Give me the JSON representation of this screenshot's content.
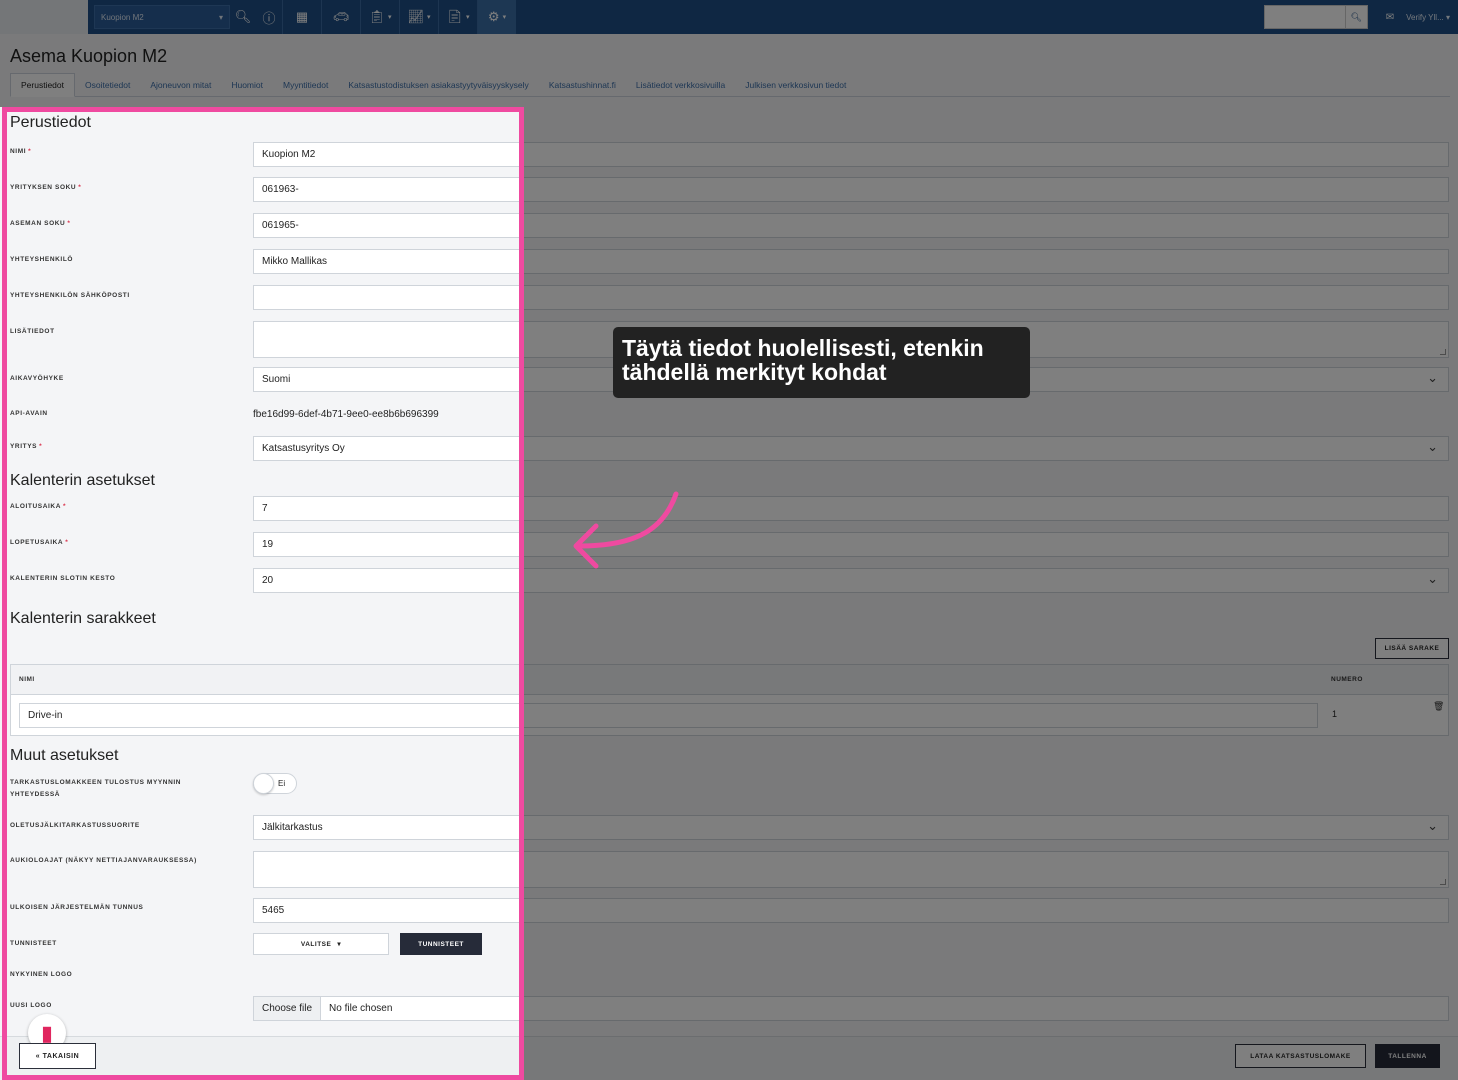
{
  "topbar": {
    "station_select": "Kuopion M2",
    "user": "Verify Yll...",
    "icons": [
      "search-icon",
      "info-icon",
      "calendar-icon",
      "car-icon",
      "clipboard-icon",
      "chart-icon",
      "document-icon",
      "gear-icon"
    ]
  },
  "page": {
    "title": "Asema Kuopion M2",
    "tabs": [
      "Perustiedot",
      "Osoitetiedot",
      "Ajoneuvon mitat",
      "Huomiot",
      "Myyntitiedot",
      "Katsastustodistuksen asiakastyytyväisyyskysely",
      "Katsastushinnat.fi",
      "Lisätiedot verkkosivuilla",
      "Julkisen verkkosivun tiedot"
    ]
  },
  "sections": {
    "basic": "Perustiedot",
    "calendar_settings": "Kalenterin asetukset",
    "calendar_columns": "Kalenterin sarakkeet",
    "other_settings": "Muut asetukset"
  },
  "fields": {
    "name": {
      "label": "NIMI",
      "value": "Kuopion M2",
      "required": "*"
    },
    "company_id": {
      "label": "YRITYKSEN SOKU",
      "value": "061963-",
      "required": "*"
    },
    "station_id": {
      "label": "ASEMAN SOKU",
      "value": "061965-",
      "required": "*"
    },
    "contact": {
      "label": "YHTEYSHENKILÖ",
      "value": "Mikko Mallikas"
    },
    "contact_email": {
      "label": "YHTEYSHENKILÖN SÄHKÖPOSTI",
      "value": ""
    },
    "extra_info": {
      "label": "LISÄTIEDOT",
      "value": ""
    },
    "timezone": {
      "label": "AIKAVYÖHYKE",
      "value": "Suomi"
    },
    "api_key": {
      "label": "API-AVAIN",
      "value": "fbe16d99-6def-4b71-9ee0-ee8b6b696399"
    },
    "company": {
      "label": "YRITYS",
      "value": "Katsastusyritys Oy",
      "required": "*"
    },
    "start_time": {
      "label": "ALOITUSAIKA",
      "value": "7",
      "required": "*"
    },
    "end_time": {
      "label": "LOPETUSAIKA",
      "value": "19",
      "required": "*"
    },
    "slot_length": {
      "label": "KALENTERIN SLOTIN KESTO",
      "value": "20"
    },
    "print_form": {
      "label": "TARKASTUSLOMAKKEEN TULOSTUS MYYNNIN YHTEYDESSÄ",
      "value": "Ei"
    },
    "default_reinspection": {
      "label": "OLETUSJÄLKITARKASTUSSUORITE",
      "value": "Jälkitarkastus"
    },
    "opening_hours": {
      "label": "AUKIOLOAJAT (NÄKYY NETTIAJANVARAUKSESSA)",
      "value": ""
    },
    "external_id": {
      "label": "ULKOISEN JÄRJESTELMÄN TUNNUS",
      "value": "5465"
    },
    "tags": {
      "label": "TUNNISTEET",
      "select_label": "VALITSE",
      "button_label": "TUNNISTEET"
    },
    "current_logo": {
      "label": "NYKYINEN LOGO"
    },
    "new_logo": {
      "label": "UUSI LOGO",
      "button": "Choose file",
      "status": "No file chosen"
    }
  },
  "columns_table": {
    "add_button": "LISÄÄ SARAKE",
    "headers": {
      "name": "NIMI",
      "number": "NUMERO"
    },
    "rows": [
      {
        "name": "Drive-in",
        "number": "1"
      }
    ]
  },
  "footer": {
    "back": "TAKAISIN",
    "download": "LATAA KATSASTUSLOMAKE",
    "save": "TALLENNA"
  },
  "tutorial": {
    "tooltip": "Täytä tiedot huolellisesti, etenkin tähdellä merkityt kohdat",
    "highlight_color": "#ef4aa0"
  }
}
